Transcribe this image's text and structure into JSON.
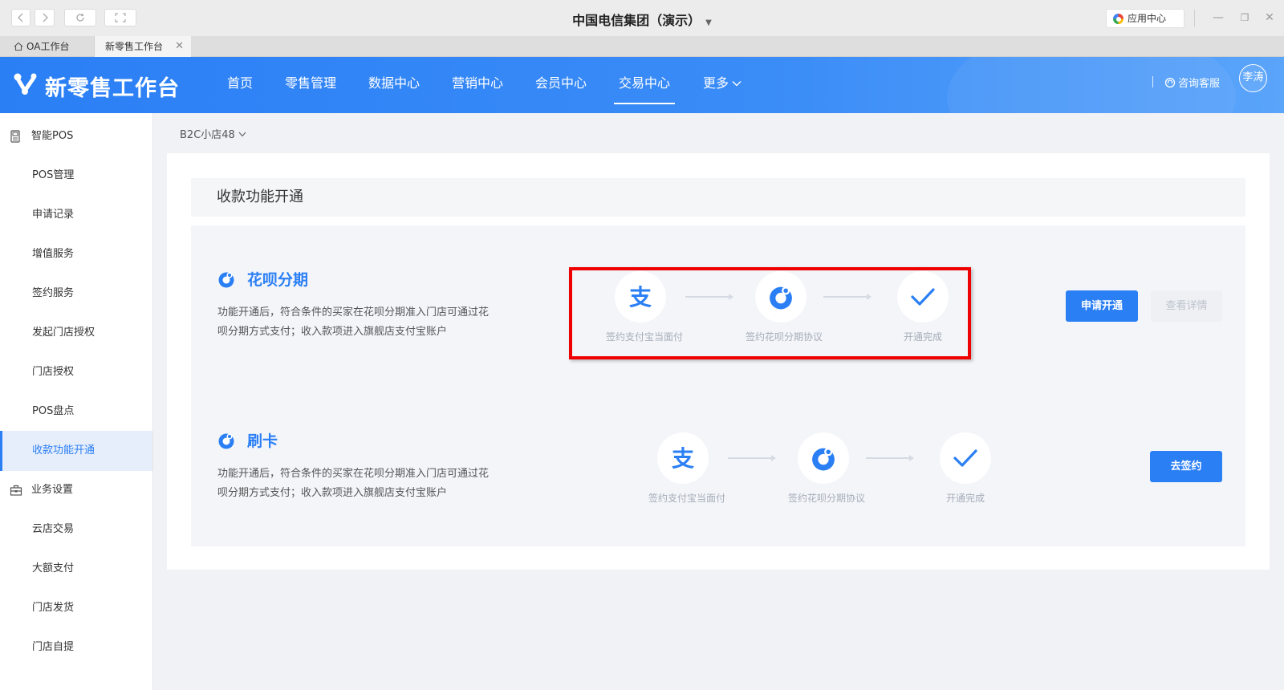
{
  "window": {
    "title": "中国电信集团（演示）",
    "app_center": "应用中心",
    "controls": [
      "minimize-icon",
      "restore-icon",
      "close-icon"
    ]
  },
  "tabs": [
    {
      "label": "OA工作台",
      "icon": "home-icon"
    },
    {
      "label": "新零售工作台",
      "active": true
    }
  ],
  "header": {
    "brand": "新零售工作台",
    "nav": [
      "首页",
      "零售管理",
      "数据中心",
      "营销中心",
      "会员中心",
      "交易中心",
      "更多"
    ],
    "active_nav": "交易中心",
    "consult": "咨询客服",
    "avatar": "李涛"
  },
  "sidebar": {
    "groups": [
      {
        "label": "智能POS",
        "icon": "pos-icon",
        "items": [
          "POS管理",
          "申请记录",
          "增值服务",
          "签约服务",
          "发起门店授权",
          "门店授权",
          "POS盘点",
          "收款功能开通"
        ]
      },
      {
        "label": "业务设置",
        "icon": "settings-icon",
        "items": [
          "云店交易",
          "大额支付",
          "门店发货",
          "门店自提"
        ]
      }
    ],
    "active_item": "收款功能开通"
  },
  "store_select": "B2C小店48",
  "page_title": "收款功能开通",
  "services": [
    {
      "name": "花呗分期",
      "desc": "功能开通后，符合条件的买家在花呗分期准入门店可通过花呗分期方式支付；收入款项进入旗舰店支付宝账户",
      "steps": [
        "签约支付宝当面付",
        "签约花呗分期协议",
        "开通完成"
      ],
      "buttons": [
        "申请开通",
        "查看详情"
      ]
    },
    {
      "name": "刷卡",
      "desc": "功能开通后，符合条件的买家在花呗分期准入门店可通过花呗分期方式支付；收入款项进入旗舰店支付宝账户",
      "steps": [
        "签约支付宝当面付",
        "签约花呗分期协议",
        "开通完成"
      ],
      "buttons": [
        "去签约"
      ]
    }
  ],
  "colors": {
    "primary": "#2b7ff5",
    "highlight": "#e00000"
  }
}
